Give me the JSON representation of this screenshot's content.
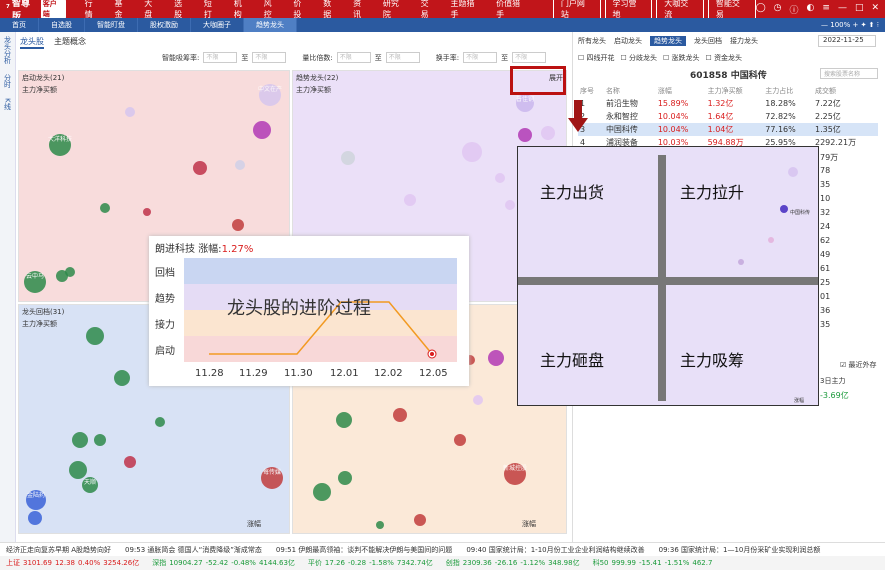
{
  "app": {
    "logo": "智尊版",
    "logo_mark": "客户端"
  },
  "menu": [
    "行情",
    "基金",
    "大盘",
    "选股",
    "短打",
    "机构",
    "风控",
    "价投",
    "数据",
    "资讯",
    "研究院",
    "交易",
    "主题猎手",
    "价值猎手"
  ],
  "menu_buttons": [
    "门户网站",
    "学习营地",
    "大咖交流",
    "智能交易"
  ],
  "zoom_level": "100%",
  "tabs": [
    "首页",
    "自选股",
    "智能盯盘",
    "股权激励",
    "大咖圈子",
    "趋势龙头"
  ],
  "leftrail": [
    "龙头分析",
    "分时",
    "K线"
  ],
  "subtabs": [
    "龙头股",
    "主题概念"
  ],
  "filters": [
    {
      "label": "智能吸筹率:",
      "ph": "不限"
    },
    {
      "label": "量比倍数:",
      "ph": "不限"
    },
    {
      "label": "换手率:",
      "ph": "不限"
    }
  ],
  "filter_to": "至",
  "quads": {
    "q1": {
      "title": "启动龙头(21)",
      "sub": "主力净买额"
    },
    "q2": {
      "title": "趋势龙头(22)",
      "sub": "主力净买额",
      "expand": "展开"
    },
    "q3": {
      "title": "龙头回档(31)",
      "sub": "主力净买额",
      "x": "涨幅"
    },
    "q4": {
      "x": "涨幅"
    }
  },
  "labels": {
    "l1": "中文在产",
    "l2": "大洋科技",
    "l3": "云中马",
    "l4": "普佳铜",
    "l5": "每传媒",
    "l6": "新城控股",
    "l7": "天顺",
    "l8": "金陆药",
    "l9": "中广数"
  },
  "popup": {
    "name": "朗进科技",
    "chg_label": "涨幅:",
    "chg": "1.27%",
    "title": "龙头股的进阶过程",
    "bands": [
      "回档",
      "趋势",
      "接力",
      "启动"
    ],
    "x": [
      "11.28",
      "11.29",
      "11.30",
      "12.01",
      "12.02",
      "12.05"
    ]
  },
  "zoom": {
    "q1": "主力出货",
    "q2": "主力拉升",
    "q3": "主力砸盘",
    "q4": "主力吸筹",
    "x": "涨幅",
    "tag": "中国科传"
  },
  "right": {
    "tabs": [
      "所有龙头",
      "启动龙头",
      "趋势龙头",
      "龙头回档",
      "接力龙头"
    ],
    "date": "2022-11-25",
    "checks": [
      "四线开花",
      "分歧龙头",
      "涨跌龙头",
      "资金龙头"
    ],
    "stock": "601858  中国科传",
    "search": "搜索股票名称",
    "cols": [
      "序号",
      "名称",
      "涨幅",
      "主力净买额",
      "主力占比",
      "成交额"
    ],
    "rows": [
      [
        "1",
        "前沿生物",
        "15.89%",
        "1.32亿",
        "18.28%",
        "7.22亿"
      ],
      [
        "2",
        "永和智控",
        "10.04%",
        "1.64亿",
        "72.82%",
        "2.25亿"
      ],
      [
        "3",
        "中国科传",
        "10.04%",
        "1.04亿",
        "77.16%",
        "1.35亿"
      ],
      [
        "4",
        "浦润装备",
        "10.03%",
        "594.88万",
        "25.95%",
        "2292.21万"
      ]
    ],
    "side": [
      "79万",
      "78",
      "35",
      "10",
      "32",
      "24",
      "62",
      "49",
      "61",
      "25",
      "01",
      "36",
      "35"
    ],
    "side_cb": "最近外存",
    "side_h": "3日主力",
    "side_v": "-3.69亿"
  },
  "news": [
    "经济正走向复苏早期 A股趋势向好",
    "09:53 通胀简会 德国人“消费降级”渐成常态",
    "09:51 伊朗最高领袖：谈判不能解决伊朗与美国间的问题",
    "09:40 国家统计局：1-10月份工业企业利润结构继续改善",
    "09:36 国家统计局：1—10月份采矿业实现利润总额"
  ],
  "ticker": [
    {
      "n": "上证",
      "v": "3101.69",
      "c": "12.38",
      "p": "0.40%",
      "a": "3254.26亿",
      "up": true
    },
    {
      "n": "深指",
      "v": "10904.27",
      "c": "-52.42",
      "p": "-0.48%",
      "a": "4144.63亿",
      "up": false
    },
    {
      "n": "平价",
      "v": "17.26",
      "c": "-0.28",
      "p": "-1.58%",
      "a": "7342.74亿",
      "up": false
    },
    {
      "n": "创指",
      "v": "2309.36",
      "c": "-26.16",
      "p": "-1.12%",
      "a": "348.98亿",
      "up": false
    },
    {
      "n": "科50",
      "v": "999.99",
      "c": "-15.41",
      "p": "-1.51%",
      "a": "462.7",
      "up": false
    }
  ]
}
